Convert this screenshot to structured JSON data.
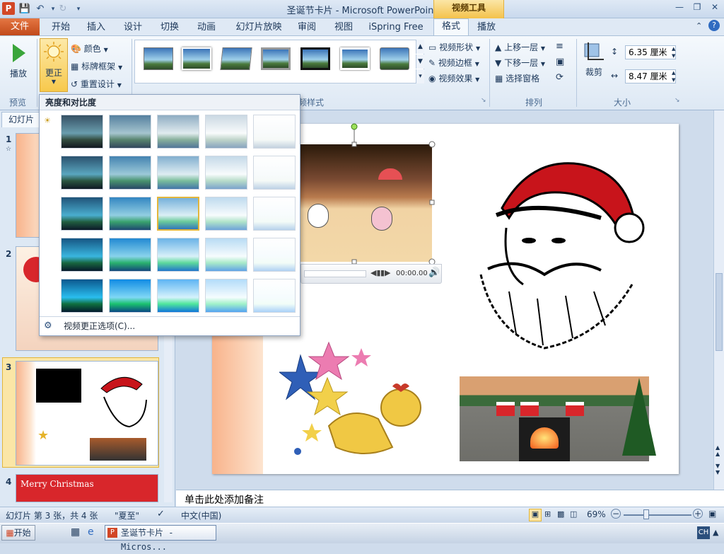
{
  "title_bar": {
    "app_logo": "P",
    "document_title": "圣诞节卡片 - Microsoft PowerPoint",
    "contextual_tools": "视频工具"
  },
  "tabs": {
    "file": "文件",
    "items": [
      "开始",
      "插入",
      "设计",
      "切换",
      "动画",
      "幻灯片放映",
      "审阅",
      "视图",
      "iSpring Free",
      "格式",
      "播放"
    ]
  },
  "ribbon": {
    "play_label": "播放",
    "preview_group": "预览",
    "correct_label": "更正",
    "color_label": "颜色",
    "frame_label": "标牌框架",
    "reset_label": "重置设计",
    "style_group_suffix": "频样式",
    "video_shape": "视频形状",
    "video_border": "视频边框",
    "video_effect": "视频效果",
    "bring_forward": "上移一层",
    "send_backward": "下移一层",
    "selection_pane": "选择窗格",
    "arrange_group": "排列",
    "crop_label": "裁剪",
    "height_value": "6.35 厘米",
    "width_value": "8.47 厘米",
    "size_group": "大小"
  },
  "dropdown": {
    "header": "亮度和对比度",
    "footer": "视频更正选项(C)..."
  },
  "sidebar": {
    "tab_label": "幻灯片",
    "slide_numbers": [
      "1",
      "2",
      "3",
      "4"
    ],
    "slide4_title": "Merry Christmas"
  },
  "video_player": {
    "time": "00:00.00"
  },
  "notes": {
    "placeholder": "单击此处添加备注"
  },
  "status_bar": {
    "slide_info": "幻灯片 第 3 张，共 4 张",
    "theme": "\"夏至\"",
    "language": "中文(中国)",
    "zoom": "69%"
  },
  "taskbar": {
    "start": "开始",
    "task_item": "圣诞节卡片 - Micros...",
    "ime": "CH"
  }
}
